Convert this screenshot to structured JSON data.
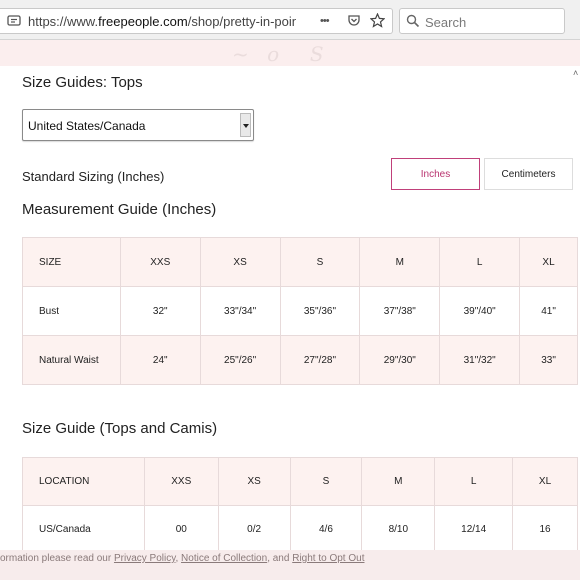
{
  "browser": {
    "url_prefix": "https://www.",
    "url_host": "freepeople.com",
    "url_path": "/shop/pretty-in-pointe",
    "search_placeholder": "Search",
    "more_icon": "•••"
  },
  "page": {
    "section_title": "Size Guides: Tops",
    "region_select": "United States/Canada",
    "standard_sizing": "Standard Sizing (Inches)",
    "unit_inches": "Inches",
    "unit_centimeters": "Centimeters",
    "measurement_title": "Measurement Guide (Inches)",
    "tops_title": "Size Guide (Tops and Camis)"
  },
  "measurement_table": {
    "headers": [
      "SIZE",
      "XXS",
      "XS",
      "S",
      "M",
      "L",
      "XL"
    ],
    "rows": [
      [
        "Bust",
        "32\"",
        "33\"/34\"",
        "35\"/36\"",
        "37\"/38\"",
        "39\"/40\"",
        "41\""
      ],
      [
        "Natural Waist",
        "24\"",
        "25\"/26\"",
        "27\"/28\"",
        "29\"/30\"",
        "31\"/32\"",
        "33\""
      ]
    ]
  },
  "tops_table": {
    "headers": [
      "LOCATION",
      "XXS",
      "XS",
      "S",
      "M",
      "L",
      "XL"
    ],
    "rows": [
      [
        "US/Canada",
        "00",
        "0/2",
        "4/6",
        "8/10",
        "12/14",
        "16"
      ]
    ]
  },
  "cookie_bar": {
    "text_start": "ormation please read our ",
    "privacy_link": "Privacy Policy",
    "sep": ", ",
    "collection_link": "Notice of Collection",
    "and_text": ", and ",
    "opt_out_link": "Right to Opt Out"
  },
  "colors": {
    "accent": "#b8336f",
    "table_header_bg": "#fdf2f0",
    "banner_bg": "#fbeeee"
  }
}
